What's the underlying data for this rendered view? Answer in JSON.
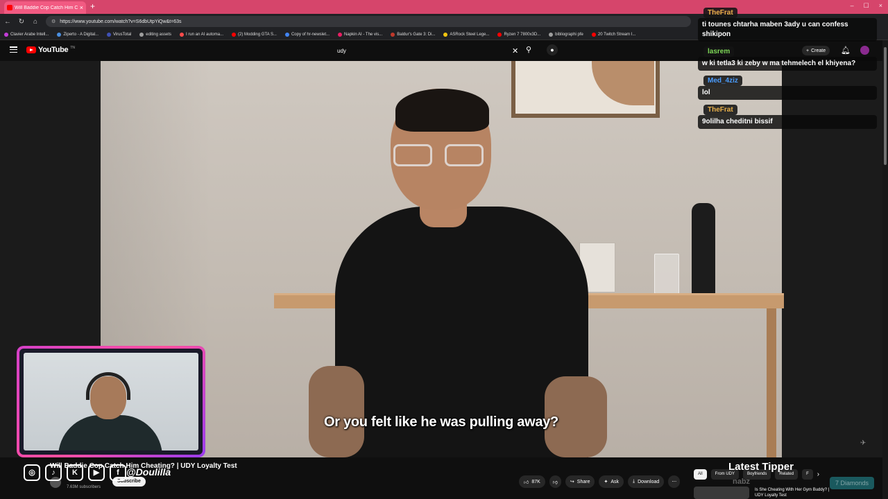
{
  "browser": {
    "tab_title": "Will Baddie Cop Catch Him Cheati",
    "new_tab": "+",
    "url": "https://www.youtube.com/watch?v=S6dbUtpYiQw&t=63s",
    "bookmarks": [
      {
        "label": "Clavier Arabe Intell...",
        "color": "#c33cd9"
      },
      {
        "label": "Ziperto - A Digital...",
        "color": "#4a90e2"
      },
      {
        "label": "VirusTotal",
        "color": "#3f51b5"
      },
      {
        "label": "editing assets",
        "color": "#9e9e9e"
      },
      {
        "label": "I run an AI automa...",
        "color": "#ff4b4b"
      },
      {
        "label": "(2) Modding GTA S...",
        "color": "#ff0000"
      },
      {
        "label": "Copy of hr-newslet...",
        "color": "#4285f4"
      },
      {
        "label": "Napkin AI - The vis...",
        "color": "#e91e63"
      },
      {
        "label": "Baldur's Gate 3: Di...",
        "color": "#c0392b"
      },
      {
        "label": "ASRock Steel Lege...",
        "color": "#f1c40f"
      },
      {
        "label": "Ryzen 7 7800x3D...",
        "color": "#ff0000"
      },
      {
        "label": "bibliographi pfe",
        "color": "#9e9e9e"
      },
      {
        "label": "20 Twitch Stream I...",
        "color": "#ff0000"
      }
    ]
  },
  "youtube": {
    "logo_text": "YouTube",
    "logo_tn": "TN",
    "search_query": "udy",
    "create_label": "Create",
    "video_title": "Will Baddie Cop Catch Him Cheating? | UDY Loyalty Test",
    "subscribers": "7.63M subscribers",
    "subscribe_label": "Subscribe",
    "actions": {
      "like_count": "87K",
      "share": "Share",
      "ask": "Ask",
      "download": "Download"
    },
    "chips": [
      "All",
      "From UDY",
      "Boyfriends",
      "Related",
      "F"
    ],
    "recommendation_title": "Is She Cheating With Her Gym Buddy? | UDY Loyalty Test"
  },
  "video": {
    "caption": "Or you felt like he was pulling away?"
  },
  "overlay": {
    "handle": "@Doulilla",
    "latest_tipper_label": "Latest Tipper",
    "tipper_name": "nabz",
    "diamonds": "7 Diamonds",
    "chat": [
      {
        "user": "TheFrat",
        "color": "#e8b04a",
        "message": "ti tounes chtarha maben 3ady u can confess shikipon"
      },
      {
        "user": "lasrem",
        "color": "#7ed957",
        "message": "w ki tetla3 ki zeby w ma tehmelech el khiyena?"
      },
      {
        "user": "Med_4ziz",
        "color": "#4a9cff",
        "message": "lol"
      },
      {
        "user": "TheFrat",
        "color": "#e8b04a",
        "message": "9olilha cheditni bissif"
      }
    ]
  }
}
